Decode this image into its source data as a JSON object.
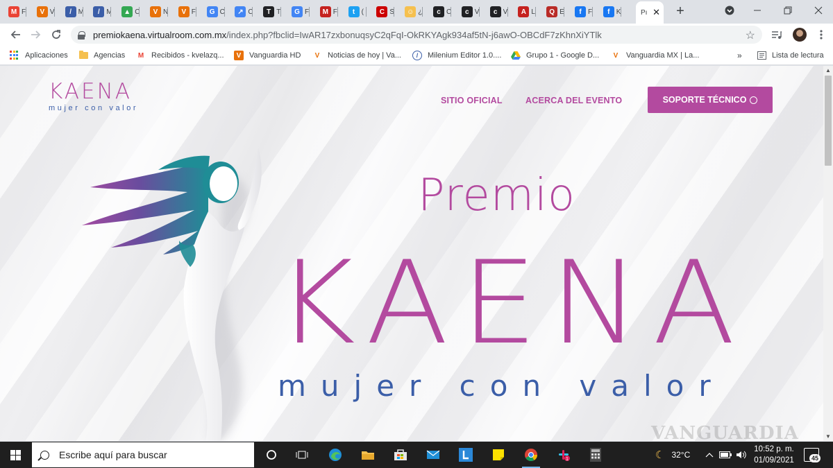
{
  "browser": {
    "tabs": [
      {
        "icon": "gmail-icon",
        "label": "F",
        "color": "#ea4335",
        "glyph": "M"
      },
      {
        "icon": "vanguardia-icon",
        "label": "V",
        "color": "#e8710a",
        "glyph": "V"
      },
      {
        "icon": "milenium-icon",
        "label": "M",
        "color": "#3b5ea8",
        "glyph": "/"
      },
      {
        "icon": "milenium-icon",
        "label": "M",
        "color": "#3b5ea8",
        "glyph": "/"
      },
      {
        "icon": "drive-icon",
        "label": "C",
        "color": "#34a853",
        "glyph": "▲"
      },
      {
        "icon": "vanguardia-icon",
        "label": "N",
        "color": "#e8710a",
        "glyph": "V"
      },
      {
        "icon": "vanguardia-icon",
        "label": "F",
        "color": "#e8710a",
        "glyph": "V"
      },
      {
        "icon": "translate-icon",
        "label": "C",
        "color": "#4285f4",
        "glyph": "G"
      },
      {
        "icon": "trends-icon",
        "label": "C",
        "color": "#4285f4",
        "glyph": "↗"
      },
      {
        "icon": "nytimes-icon",
        "label": "T",
        "color": "#202124",
        "glyph": "T"
      },
      {
        "icon": "google-icon",
        "label": "F",
        "color": "#4285f4",
        "glyph": "G"
      },
      {
        "icon": "milenio-icon",
        "label": "F",
        "color": "#c5221f",
        "glyph": "M"
      },
      {
        "icon": "twitter-icon",
        "label": "(",
        "color": "#1da1f2",
        "glyph": "t"
      },
      {
        "icon": "cnn-icon",
        "label": "S",
        "color": "#cc0000",
        "glyph": "C"
      },
      {
        "icon": "emoji-icon",
        "label": "¿",
        "color": "#f5c04f",
        "glyph": "☺"
      },
      {
        "icon": "cl-icon",
        "label": "C",
        "color": "#202124",
        "glyph": "c"
      },
      {
        "icon": "cl-icon",
        "label": "V",
        "color": "#202124",
        "glyph": "c"
      },
      {
        "icon": "cl-icon",
        "label": "V",
        "color": "#202124",
        "glyph": "c"
      },
      {
        "icon": "acrobat-icon",
        "label": "L",
        "color": "#c5221f",
        "glyph": "A"
      },
      {
        "icon": "quora-icon",
        "label": "E",
        "color": "#b92b27",
        "glyph": "Q"
      },
      {
        "icon": "facebook-icon",
        "label": "F",
        "color": "#1877f2",
        "glyph": "f"
      },
      {
        "icon": "facebook-icon",
        "label": "K",
        "color": "#1877f2",
        "glyph": "f"
      }
    ],
    "active_tab": {
      "label": "Pı",
      "close": "✕"
    },
    "new_tab": "+",
    "url_host": "premiokaena.virtualroom.com.mx",
    "url_rest": "/index.php?fbclid=IwAR17zxbonuqsyC2qFqI-OkRKYAgk934af5tN-j6awO-OBCdF7zKhnXiYTlk",
    "bookmarks": [
      {
        "label": "Aplicaciones",
        "icon": "apps-icon"
      },
      {
        "label": "Agencias",
        "icon": "folder-icon"
      },
      {
        "label": "Recibidos - kvelazq...",
        "icon": "gmail-icon"
      },
      {
        "label": "Vanguardia HD",
        "icon": "vanguardia-icon"
      },
      {
        "label": "Noticias de hoy | Va...",
        "icon": "vanguardia-icon"
      },
      {
        "label": "Milenium Editor 1.0....",
        "icon": "milenium-icon"
      },
      {
        "label": "Grupo 1 - Google D...",
        "icon": "drive-icon"
      },
      {
        "label": "Vanguardia MX | La...",
        "icon": "vanguardia-icon"
      }
    ],
    "more_bookmarks": "»",
    "reading_list": "Lista de lectura"
  },
  "site": {
    "logo_word": "KAENA",
    "logo_tagline": "mujer con valor",
    "nav": {
      "official": "SITIO OFICIAL",
      "about": "ACERCA DEL EVENTO",
      "support": "SOPORTE TÉCNICO"
    },
    "hero": {
      "premio": "Premio",
      "kaena": "KAENA",
      "tagline": "mujer con valor"
    },
    "watermark": "VANGUARDIA",
    "colors": {
      "brand_magenta": "#b34a9f",
      "brand_blue": "#3b5ea8",
      "hair_teal": "#2a8a95",
      "hair_purple": "#7d4a9e"
    }
  },
  "taskbar": {
    "search_placeholder": "Escribe aquí para buscar",
    "temperature": "32°C",
    "time": "10:52 p. m.",
    "date": "01/09/2021",
    "notifications": "45"
  }
}
